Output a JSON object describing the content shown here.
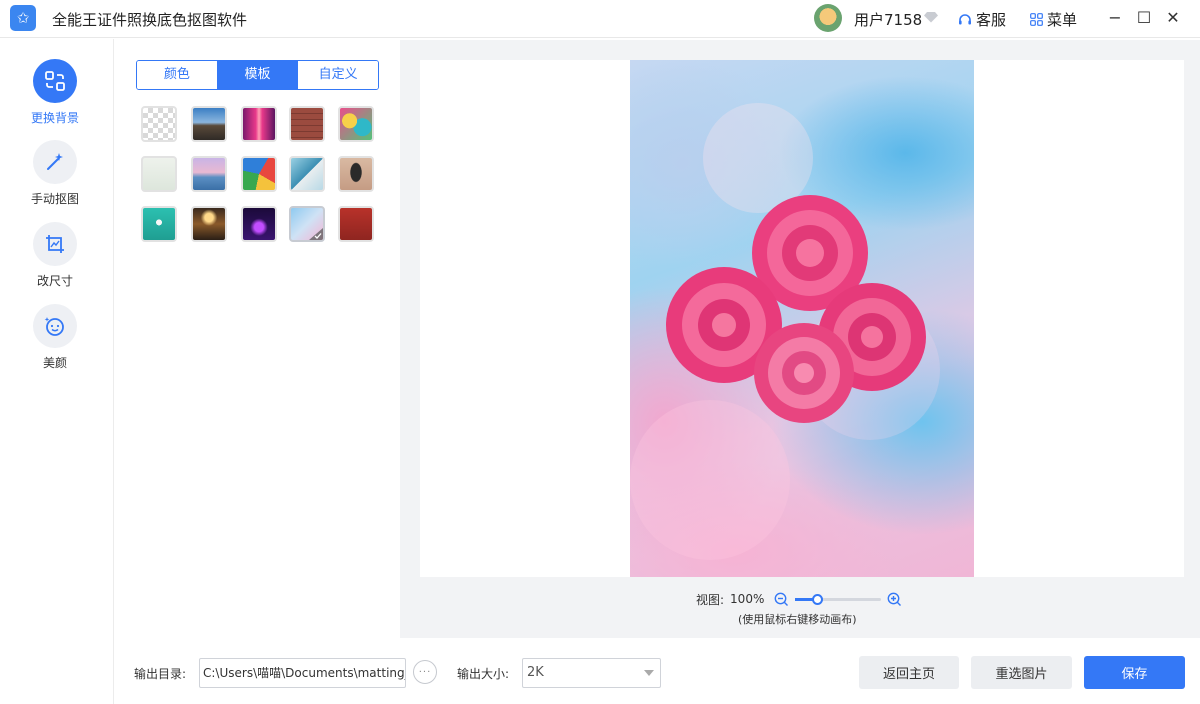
{
  "app": {
    "title": "全能王证件照换底色抠图软件",
    "logo_glyph": "✩"
  },
  "header": {
    "user_name": "用户7158",
    "service_label": "客服",
    "menu_label": "菜单",
    "minimize_glyph": "−",
    "maximize_glyph": "☐",
    "close_glyph": "✕"
  },
  "sidebar": {
    "items": [
      {
        "label": "更换背景",
        "icon": "replace-background-icon",
        "active": true
      },
      {
        "label": "手动抠图",
        "icon": "magic-wand-icon",
        "active": false
      },
      {
        "label": "改尺寸",
        "icon": "crop-image-icon",
        "active": false
      },
      {
        "label": "美颜",
        "icon": "beauty-face-icon",
        "active": false
      }
    ]
  },
  "background_panel": {
    "tabs": [
      {
        "label": "颜色",
        "active": false
      },
      {
        "label": "模板",
        "active": true
      },
      {
        "label": "自定义",
        "active": false
      }
    ],
    "selected_template_index": 13
  },
  "canvas": {
    "zoom_label": "视图:",
    "zoom_value": "100%",
    "zoom_fraction": 0.25,
    "hint": "(使用鼠标右键移动画布)"
  },
  "footer": {
    "output_dir_label": "输出目录:",
    "output_dir_value": "C:\\Users\\喵喵\\Documents\\matting_w",
    "browse_glyph": "···",
    "output_size_label": "输出大小:",
    "output_size_value": "2K",
    "back_home_label": "返回主页",
    "reselect_label": "重选图片",
    "save_label": "保存"
  },
  "colors": {
    "accent": "#3478f6",
    "panel_bg": "#f2f3f5"
  }
}
